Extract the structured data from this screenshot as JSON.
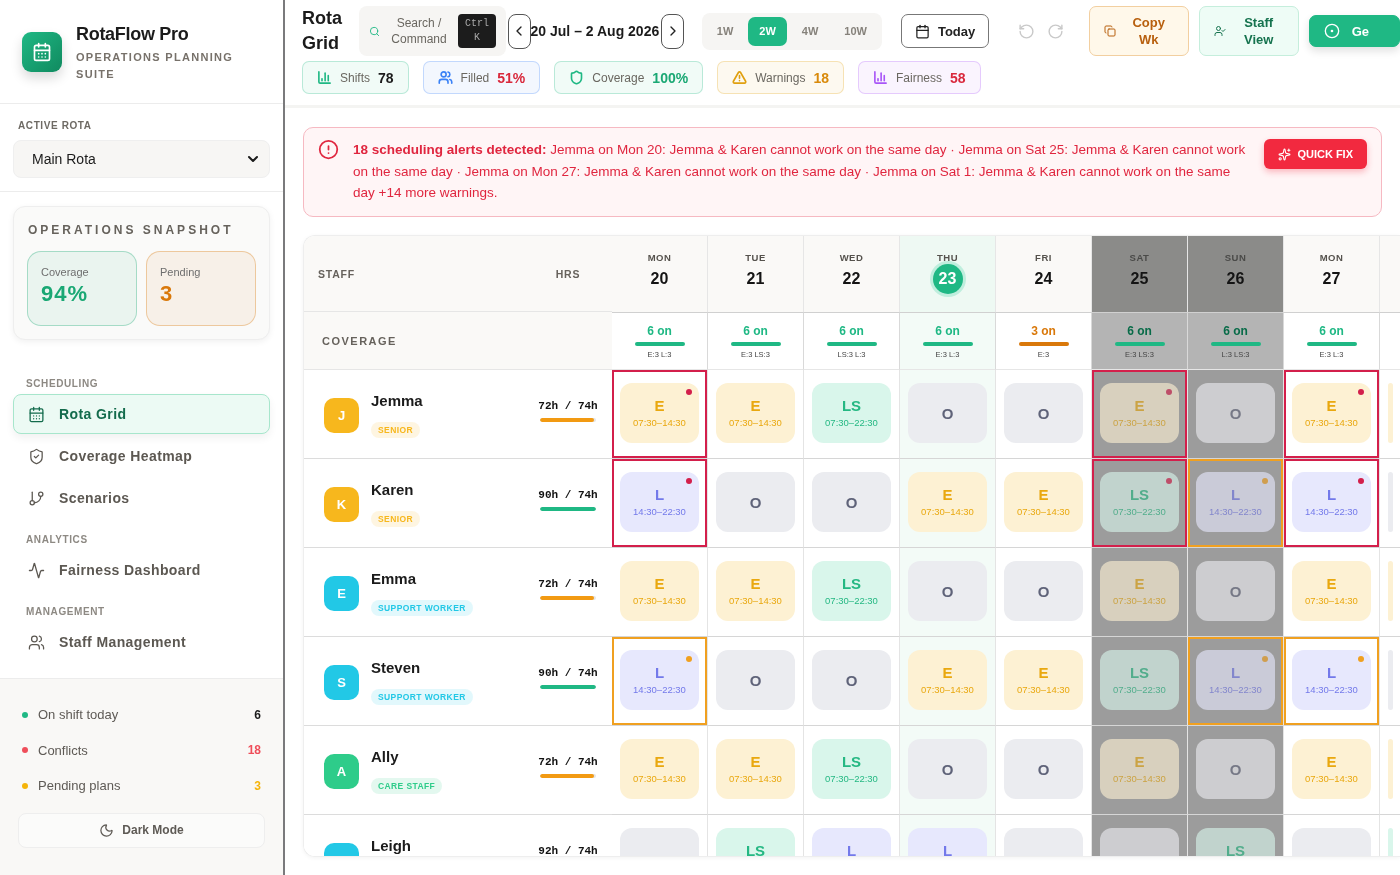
{
  "sidebar": {
    "brand": {
      "name": "RotaFlow Pro",
      "tagline": "OPERATIONS PLANNING SUITE"
    },
    "active_rota": {
      "label": "ACTIVE ROTA",
      "value": "Main Rota"
    },
    "snapshot": {
      "title": "OPERATIONS SNAPSHOT",
      "cards": [
        {
          "label": "Coverage",
          "value": "94%",
          "color": "#1aa874"
        },
        {
          "label": "Pending",
          "value": "3",
          "color": "#d9780a"
        }
      ]
    },
    "sections": [
      {
        "heading": "SCHEDULING",
        "items": [
          {
            "label": "Rota Grid",
            "selected": true
          },
          {
            "label": "Coverage Heatmap",
            "selected": false
          },
          {
            "label": "Scenarios",
            "selected": false
          }
        ]
      },
      {
        "heading": "ANALYTICS",
        "items": [
          {
            "label": "Fairness Dashboard",
            "selected": false
          }
        ]
      },
      {
        "heading": "MANAGEMENT",
        "items": [
          {
            "label": "Staff Management",
            "selected": false
          }
        ]
      }
    ],
    "status": [
      {
        "label": "On shift today",
        "value": "6",
        "color": "#1fb884",
        "kind": "neutral"
      },
      {
        "label": "Conflicts",
        "value": "18",
        "color": "#ef4e5a",
        "kind": "danger"
      },
      {
        "label": "Pending plans",
        "value": "3",
        "color": "#f5b40a",
        "kind": "warning"
      }
    ],
    "dark_mode_button": "Dark Mode"
  },
  "toolbar": {
    "title": "Rota Grid",
    "search": {
      "label": "Search / Command",
      "shortcut": "Ctrl K"
    },
    "range": "20 Jul – 2 Aug 2026",
    "ranges": [
      {
        "label": "1W",
        "selected": false
      },
      {
        "label": "2W",
        "selected": true
      },
      {
        "label": "4W",
        "selected": false
      },
      {
        "label": "10W",
        "selected": false
      }
    ],
    "today_button": "Today",
    "undo": {
      "disabled": true
    },
    "redo": {
      "disabled": true
    },
    "actions": [
      {
        "label": "Copy Wk",
        "kind": "copy"
      },
      {
        "label": "Staff View",
        "kind": "staff"
      },
      {
        "label": "Ge",
        "kind": "primary"
      }
    ],
    "stats": [
      {
        "label": "Shifts",
        "value": "78",
        "color": "#1fb884",
        "kind": "neutral"
      },
      {
        "label": "Filled",
        "value": "51%",
        "color": "#3b82f6",
        "kind": "bad"
      },
      {
        "label": "Coverage",
        "value": "100%",
        "color": "#1fb884",
        "kind": "good"
      },
      {
        "label": "Warnings",
        "value": "18",
        "color": "#e0a010",
        "kind": "warn"
      },
      {
        "label": "Fairness",
        "value": "58",
        "color": "#a855f7",
        "kind": "bad"
      }
    ]
  },
  "alert": {
    "message": "**18 scheduling alerts detected:** Jemma on Mon 20: Jemma & Karen cannot work on the same day · Jemma on Sat 25: Jemma & Karen cannot work on the same day · Jemma on Mon 27: Jemma & Karen cannot work on the same day · Jemma on Sat 1: Jemma & Karen cannot work on the same day +14 more warnings.",
    "action": "QUICK FIX"
  },
  "grid": {
    "staff_heading": "STAFF",
    "hours_heading": "HRS",
    "coverage_label": "COVERAGE",
    "days": [
      {
        "weekday": "MON",
        "date": "20",
        "today": false,
        "weekend": false,
        "coverage": {
          "count": "6 on",
          "mix": "E:3 L:3",
          "kind": "ok"
        }
      },
      {
        "weekday": "TUE",
        "date": "21",
        "today": false,
        "weekend": false,
        "coverage": {
          "count": "6 on",
          "mix": "E:3 LS:3",
          "kind": "ok"
        }
      },
      {
        "weekday": "WED",
        "date": "22",
        "today": false,
        "weekend": false,
        "coverage": {
          "count": "6 on",
          "mix": "LS:3 L:3",
          "kind": "ok"
        }
      },
      {
        "weekday": "THU",
        "date": "23",
        "today": true,
        "weekend": false,
        "coverage": {
          "count": "6 on",
          "mix": "E:3 L:3",
          "kind": "ok"
        }
      },
      {
        "weekday": "FRI",
        "date": "24",
        "today": false,
        "weekend": false,
        "coverage": {
          "count": "3 on",
          "mix": "E:3",
          "kind": "low"
        }
      },
      {
        "weekday": "SAT",
        "date": "25",
        "today": false,
        "weekend": true,
        "coverage": {
          "count": "6 on",
          "mix": "E:3 LS:3",
          "kind": "ok"
        }
      },
      {
        "weekday": "SUN",
        "date": "26",
        "today": false,
        "weekend": true,
        "coverage": {
          "count": "6 on",
          "mix": "L:3 LS:3",
          "kind": "ok"
        }
      },
      {
        "weekday": "MON",
        "date": "27",
        "today": false,
        "weekend": false,
        "coverage": {
          "count": "6 on",
          "mix": "E:3 L:3",
          "kind": "ok"
        }
      },
      {
        "today": false,
        "weekend": false
      }
    ],
    "staff": [
      {
        "initial": "J",
        "name": "Jemma",
        "role": "SENIOR",
        "color": "#f7b71d",
        "hours": {
          "text": "72h / 74h",
          "level": 0.97,
          "color": "#f29a12"
        },
        "shifts": [
          {
            "kind": "early",
            "code": "E",
            "time": "07:30–14:30",
            "conflict": true,
            "warning": false
          },
          {
            "kind": "early",
            "code": "E",
            "time": "07:30–14:30",
            "conflict": false,
            "warning": false
          },
          {
            "kind": "long",
            "code": "LS",
            "time": "07:30–22:30",
            "conflict": false,
            "warning": false
          },
          {
            "kind": "off",
            "code": "O",
            "conflict": false,
            "warning": false
          },
          {
            "kind": "off",
            "code": "O",
            "conflict": false,
            "warning": false
          },
          {
            "kind": "early",
            "code": "E",
            "time": "07:30–14:30",
            "conflict": true,
            "warning": false
          },
          {
            "kind": "off",
            "code": "O",
            "conflict": false,
            "warning": false
          },
          {
            "kind": "early",
            "code": "E",
            "time": "07:30–14:30",
            "conflict": true,
            "warning": false
          },
          {
            "kind": "early",
            "conflict": false,
            "warning": false
          }
        ]
      },
      {
        "initial": "K",
        "name": "Karen",
        "role": "SENIOR",
        "color": "#f7b71d",
        "hours": {
          "text": "90h / 74h",
          "level": 1,
          "color": "#1fb884"
        },
        "shifts": [
          {
            "kind": "late",
            "code": "L",
            "time": "14:30–22:30",
            "conflict": true,
            "warning": false
          },
          {
            "kind": "off",
            "code": "O",
            "conflict": false,
            "warning": false
          },
          {
            "kind": "off",
            "code": "O",
            "conflict": false,
            "warning": false
          },
          {
            "kind": "early",
            "code": "E",
            "time": "07:30–14:30",
            "conflict": false,
            "warning": false
          },
          {
            "kind": "early",
            "code": "E",
            "time": "07:30–14:30",
            "conflict": false,
            "warning": false
          },
          {
            "kind": "long",
            "code": "LS",
            "time": "07:30–22:30",
            "conflict": true,
            "warning": false
          },
          {
            "kind": "late",
            "code": "L",
            "time": "14:30–22:30",
            "conflict": false,
            "warning": true
          },
          {
            "kind": "late",
            "code": "L",
            "time": "14:30–22:30",
            "conflict": true,
            "warning": false
          },
          {
            "kind": "off",
            "conflict": false,
            "warning": false
          }
        ]
      },
      {
        "initial": "E",
        "name": "Emma",
        "role": "SUPPORT WORKER",
        "color": "#22c8e6",
        "hours": {
          "text": "72h / 74h",
          "level": 0.97,
          "color": "#f29a12"
        },
        "shifts": [
          {
            "kind": "early",
            "code": "E",
            "time": "07:30–14:30",
            "conflict": false,
            "warning": false
          },
          {
            "kind": "early",
            "code": "E",
            "time": "07:30–14:30",
            "conflict": false,
            "warning": false
          },
          {
            "kind": "long",
            "code": "LS",
            "time": "07:30–22:30",
            "conflict": false,
            "warning": false
          },
          {
            "kind": "off",
            "code": "O",
            "conflict": false,
            "warning": false
          },
          {
            "kind": "off",
            "code": "O",
            "conflict": false,
            "warning": false
          },
          {
            "kind": "early",
            "code": "E",
            "time": "07:30–14:30",
            "conflict": false,
            "warning": false
          },
          {
            "kind": "off",
            "code": "O",
            "conflict": false,
            "warning": false
          },
          {
            "kind": "early",
            "code": "E",
            "time": "07:30–14:30",
            "conflict": false,
            "warning": false
          },
          {
            "kind": "early",
            "conflict": false,
            "warning": false
          }
        ]
      },
      {
        "initial": "S",
        "name": "Steven",
        "role": "SUPPORT WORKER",
        "color": "#22c8e6",
        "hours": {
          "text": "90h / 74h",
          "level": 1,
          "color": "#1fb884"
        },
        "shifts": [
          {
            "kind": "late",
            "code": "L",
            "time": "14:30–22:30",
            "conflict": false,
            "warning": true
          },
          {
            "kind": "off",
            "code": "O",
            "conflict": false,
            "warning": false
          },
          {
            "kind": "off",
            "code": "O",
            "conflict": false,
            "warning": false
          },
          {
            "kind": "early",
            "code": "E",
            "time": "07:30–14:30",
            "conflict": false,
            "warning": false
          },
          {
            "kind": "early",
            "code": "E",
            "time": "07:30–14:30",
            "conflict": false,
            "warning": false
          },
          {
            "kind": "long",
            "code": "LS",
            "time": "07:30–22:30",
            "conflict": false,
            "warning": false
          },
          {
            "kind": "late",
            "code": "L",
            "time": "14:30–22:30",
            "conflict": false,
            "warning": true
          },
          {
            "kind": "late",
            "code": "L",
            "time": "14:30–22:30",
            "conflict": false,
            "warning": true
          },
          {
            "kind": "off",
            "conflict": false,
            "warning": false
          }
        ]
      },
      {
        "initial": "A",
        "name": "Ally",
        "role": "CARE STAFF",
        "color": "#2ecc8a",
        "hours": {
          "text": "72h / 74h",
          "level": 0.97,
          "color": "#f29a12"
        },
        "shifts": [
          {
            "kind": "early",
            "code": "E",
            "time": "07:30–14:30",
            "conflict": false,
            "warning": false
          },
          {
            "kind": "early",
            "code": "E",
            "time": "07:30–14:30",
            "conflict": false,
            "warning": false
          },
          {
            "kind": "long",
            "code": "LS",
            "time": "07:30–22:30",
            "conflict": false,
            "warning": false
          },
          {
            "kind": "off",
            "code": "O",
            "conflict": false,
            "warning": false
          },
          {
            "kind": "off",
            "code": "O",
            "conflict": false,
            "warning": false
          },
          {
            "kind": "early",
            "code": "E",
            "time": "07:30–14:30",
            "conflict": false,
            "warning": false
          },
          {
            "kind": "off",
            "code": "O",
            "conflict": false,
            "warning": false
          },
          {
            "kind": "early",
            "code": "E",
            "time": "07:30–14:30",
            "conflict": false,
            "warning": false
          },
          {
            "kind": "early",
            "conflict": false,
            "warning": false
          }
        ]
      },
      {
        "name": "Leigh",
        "color": "#22c8e6",
        "hours": {
          "text": "92h / 74h"
        },
        "shifts": [
          {
            "kind": "off",
            "conflict": false,
            "warning": false
          },
          {
            "kind": "long",
            "code": "LS",
            "conflict": false,
            "warning": false
          },
          {
            "kind": "late",
            "code": "L",
            "conflict": false,
            "warning": false
          },
          {
            "kind": "late",
            "code": "L",
            "conflict": false,
            "warning": false
          },
          {
            "kind": "off",
            "conflict": false,
            "warning": false
          },
          {
            "kind": "off",
            "conflict": false,
            "warning": false
          },
          {
            "kind": "long",
            "code": "LS",
            "conflict": false,
            "warning": false
          },
          {
            "kind": "off",
            "conflict": false,
            "warning": false
          },
          {
            "kind": "long",
            "conflict": false,
            "warning": false
          }
        ]
      }
    ]
  }
}
